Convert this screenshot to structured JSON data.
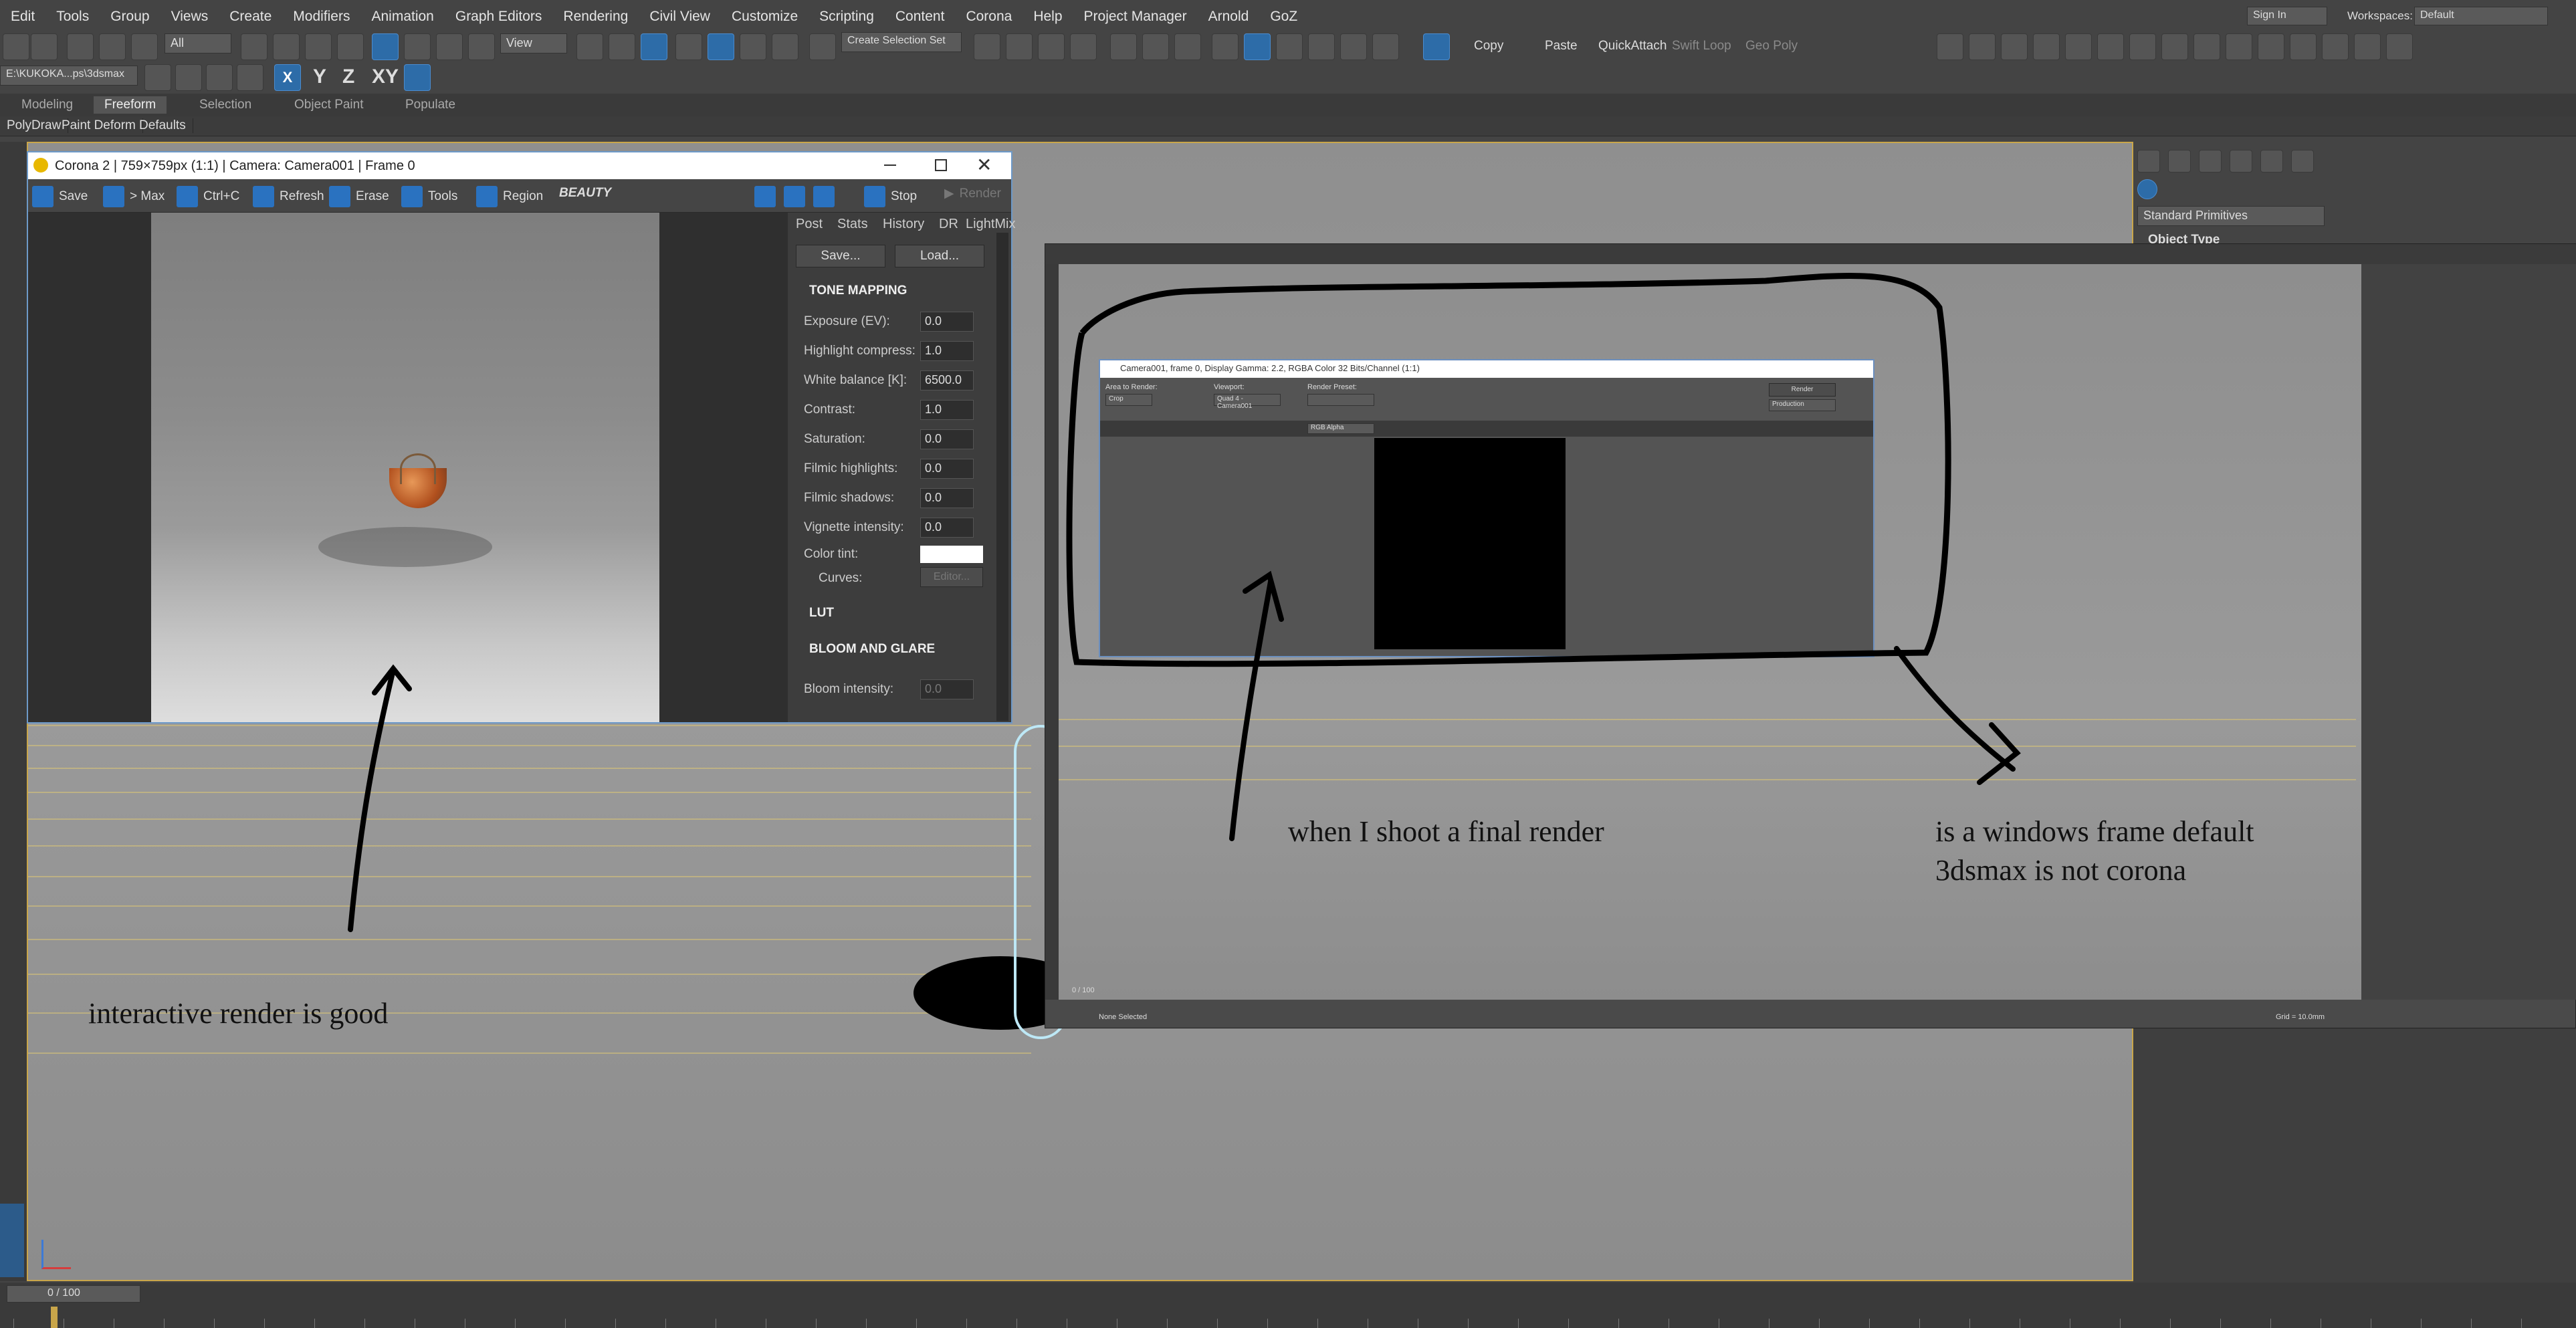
{
  "menubar": {
    "items": [
      "Edit",
      "Tools",
      "Group",
      "Views",
      "Create",
      "Modifiers",
      "Animation",
      "Graph Editors",
      "Rendering",
      "Civil View",
      "Customize",
      "Scripting",
      "Content",
      "Corona",
      "Help",
      "Project Manager",
      "Arnold",
      "GoZ"
    ],
    "sign_in": "Sign In",
    "workspaces_label": "Workspaces:",
    "workspaces_value": "Default"
  },
  "toolbar": {
    "filter_value": "All",
    "view_value": "View",
    "selection_set": "Create Selection Set",
    "copy": "Copy",
    "paste": "Paste",
    "quickattach": "QuickAttach",
    "swift_loop": "Swift Loop",
    "geo_poly": "Geo Poly",
    "path": "E:\\KUKOKA...ps\\3dsmax",
    "axis_x": "X",
    "axis_y": "Y",
    "axis_z": "Z",
    "axis_xy": "XY"
  },
  "ribbon": {
    "tabs": [
      "Modeling",
      "Freeform",
      "Selection",
      "Object Paint",
      "Populate"
    ],
    "sub_items": [
      "PolyDraw",
      "Paint Deform",
      "Defaults"
    ]
  },
  "command_panel": {
    "dropdown": "Standard Primitives",
    "rollout": "Object Type"
  },
  "timeline": {
    "frame_counter": "0 / 100"
  },
  "corona_window": {
    "title": "Corona 2 | 759×759px (1:1) | Camera: Camera001 | Frame 0",
    "toolbar": {
      "save": "Save",
      "to_max": "> Max",
      "ctrl_c": "Ctrl+C",
      "refresh": "Refresh",
      "erase": "Erase",
      "tools": "Tools",
      "region": "Region",
      "beauty": "BEAUTY",
      "stop": "Stop",
      "render": "Render"
    },
    "panel_tabs": [
      "Post",
      "Stats",
      "History",
      "DR",
      "LightMix"
    ],
    "save_btn": "Save...",
    "load_btn": "Load...",
    "tone_mapping": {
      "header": "TONE MAPPING",
      "rows": [
        {
          "label": "Exposure (EV):",
          "value": "0.0"
        },
        {
          "label": "Highlight compress:",
          "value": "1.0"
        },
        {
          "label": "White balance [K]:",
          "value": "6500.0"
        },
        {
          "label": "Contrast:",
          "value": "1.0"
        },
        {
          "label": "Saturation:",
          "value": "0.0"
        },
        {
          "label": "Filmic highlights:",
          "value": "0.0"
        },
        {
          "label": "Filmic shadows:",
          "value": "0.0"
        },
        {
          "label": "Vignette intensity:",
          "value": "0.0"
        }
      ],
      "color_tint": "Color tint:",
      "curves": "Curves:",
      "editor": "Editor..."
    },
    "lut": "LUT",
    "bloom_glare": "BLOOM AND GLARE",
    "bloom_intensity": {
      "label": "Bloom intensity:",
      "value": "0.0"
    }
  },
  "default_frame": {
    "title": "Camera001, frame 0, Display Gamma: 2.2, RGBA Color 32 Bits/Channel (1:1)",
    "area_to_render_label": "Area to Render:",
    "area_to_render_value": "Crop",
    "viewport_label": "Viewport:",
    "viewport_value": "Quad 4 - Camera001",
    "render_preset_label": "Render Preset:",
    "render_btn": "Render",
    "production": "Production",
    "channel": "RGB Alpha",
    "none_selected": "None Selected",
    "grid": "Grid = 10.0mm",
    "frame_counter": "0 / 100"
  },
  "annotations": {
    "interactive": "interactive render is good",
    "final_render": "when I shoot a final render",
    "windows_frame_line1": "is a windows frame default",
    "windows_frame_line2": "3dsmax is not corona"
  },
  "colors": {
    "accent_blue": "#2a72c0",
    "grid_yellow": "#d6c178",
    "selection_cyan": "#3aa2c2"
  }
}
